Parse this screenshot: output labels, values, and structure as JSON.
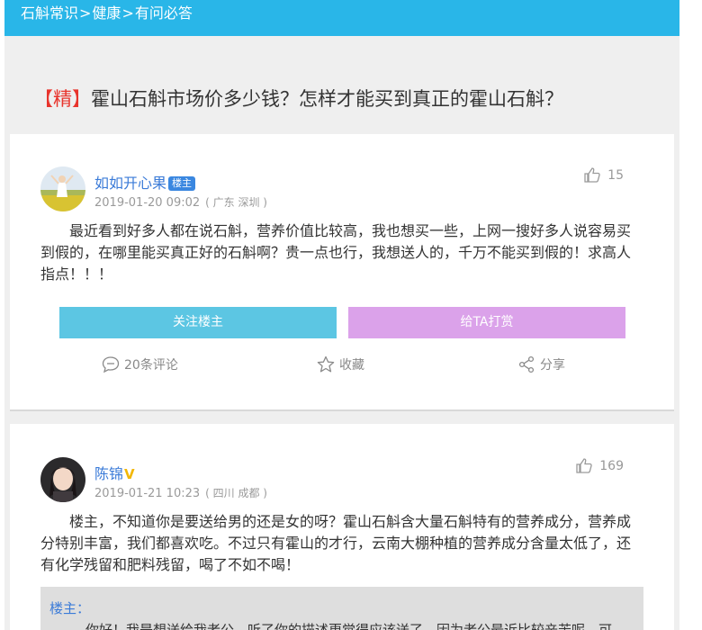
{
  "breadcrumb": {
    "item1": "石斛常识",
    "sep1": ">",
    "item2": "健康",
    "sep2": ">",
    "item3": "有问必答"
  },
  "question": {
    "tag": "【精】",
    "title": "霍山石斛市场价多少钱？怎样才能买到真正的霍山石斛？"
  },
  "post": {
    "author": "如如开心果",
    "owner_badge": "楼主",
    "datetime": "2019-01-20 09:02",
    "location": "( 广东 深圳 )",
    "likes": "15",
    "content": "最近看到好多人都在说石斛，营养价值比较高，我也想买一些，上网一搜好多人说容易买到假的，在哪里能买真正好的石斛啊？贵一点也行，我想送人的，千万不能买到假的！求高人指点！！！",
    "follow_button": "关注楼主",
    "reward_button": "给TA打赏",
    "comment_action": "20条评论",
    "favorite_action": "收藏",
    "share_action": "分享"
  },
  "reply": {
    "author": "陈锦",
    "verified_mark": "V",
    "datetime": "2019-01-21 10:23",
    "location": "( 四川 成都 )",
    "likes": "169",
    "content": "楼主，不知道你是要送给男的还是女的呀？霍山石斛含大量石斛特有的营养成分，营养成分特别丰富，我们都喜欢吃。不过只有霍山的才行，云南大棚种植的营养成分含量太低了，还有化学残留和肥料残留，喝了不如不喝！",
    "quote_label": "楼主：",
    "quote_text": "你好！我是想送给我老公，听了你的描述更觉得应该送了，因为老公最近比较辛苦呢，可"
  },
  "colors": {
    "topbar": "#29b6e8",
    "link_blue": "#3b7bd8",
    "tag_red": "#e8342c",
    "follow_button": "#5cc6e3",
    "reward_button": "#dba2ea"
  }
}
